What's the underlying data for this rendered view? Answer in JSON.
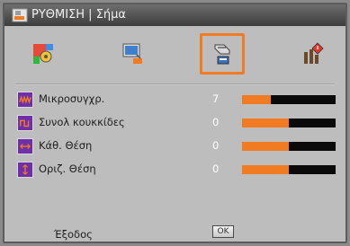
{
  "window": {
    "title": "ΡΥΘΜΙΣΗ | Σήμα"
  },
  "tabs": [
    {
      "name": "picture",
      "icon": "color-palette-icon",
      "selected": false
    },
    {
      "name": "display",
      "icon": "projection-screen-icon",
      "selected": false
    },
    {
      "name": "setup",
      "icon": "hand-setup-icon",
      "selected": true
    },
    {
      "name": "options",
      "icon": "options-info-icon",
      "selected": false
    }
  ],
  "rows": [
    {
      "label": "Μικροσυγχρ.",
      "value": "7",
      "level": 0.31,
      "icon": "frequency-wave-icon"
    },
    {
      "label": "Συνολ κουκκίδες",
      "value": "0",
      "level": 0.5,
      "icon": "phase-clock-icon"
    },
    {
      "label": "Κάθ. Θέση",
      "value": "0",
      "level": 0.5,
      "icon": "horizontal-position-icon"
    },
    {
      "label": "Οριζ. Θέση",
      "value": "0",
      "level": 0.5,
      "icon": "vertical-position-icon"
    }
  ],
  "footer": {
    "exit_label": "Έξοδος",
    "ok_label": "OK"
  },
  "colors": {
    "accent": "#f07b22",
    "panel": "#bdbdbd",
    "titlebar": "#4a4a4a",
    "row_icon": "#6f2fa8"
  }
}
